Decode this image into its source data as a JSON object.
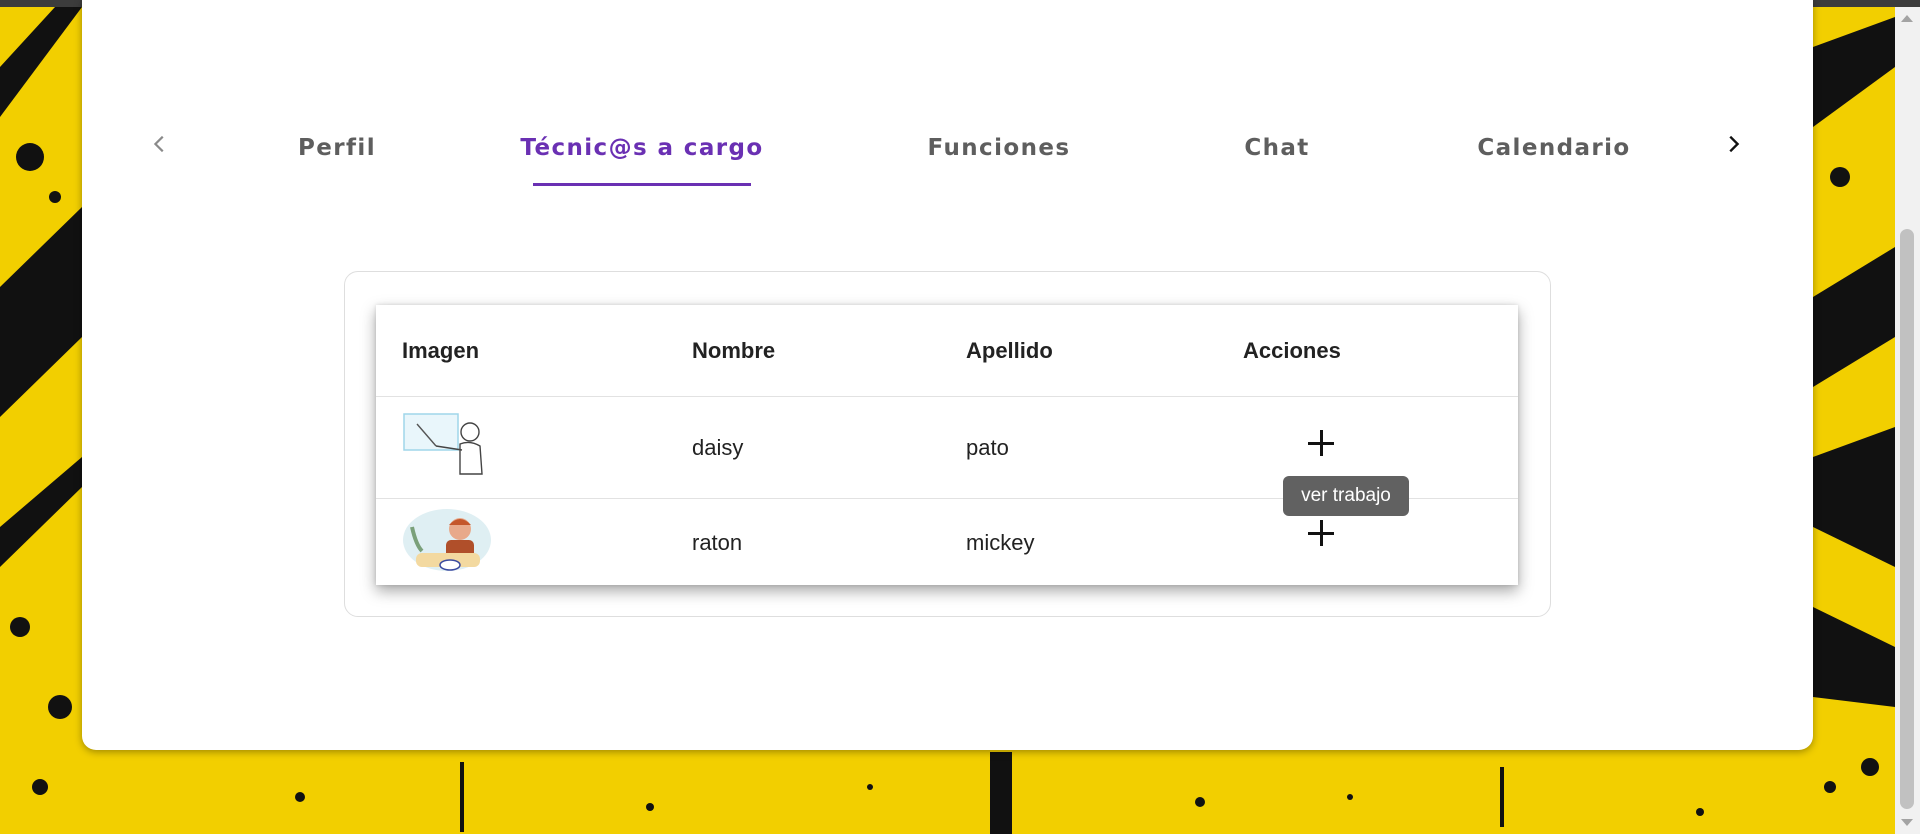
{
  "tabs": {
    "prev_icon": "chevron-left-icon",
    "next_icon": "chevron-right-icon",
    "items": [
      {
        "label": "Perfil"
      },
      {
        "label": "Técnic@s a cargo",
        "active": true
      },
      {
        "label": "Funciones"
      },
      {
        "label": "Chat"
      },
      {
        "label": "Calendario"
      }
    ]
  },
  "table": {
    "columns": [
      "Imagen",
      "Nombre",
      "Apellido",
      "Acciones"
    ],
    "rows": [
      {
        "image": "teacher-illustration",
        "nombre": "daisy",
        "apellido": "pato",
        "action_icon": "plus-icon"
      },
      {
        "image": "student-illustration",
        "nombre": "raton",
        "apellido": "mickey",
        "action_icon": "plus-icon"
      }
    ]
  },
  "tooltip": {
    "text": "ver trabajo"
  },
  "colors": {
    "accent": "#6a30b3",
    "background": "#f2cf00",
    "tooltip_bg": "#616161"
  }
}
